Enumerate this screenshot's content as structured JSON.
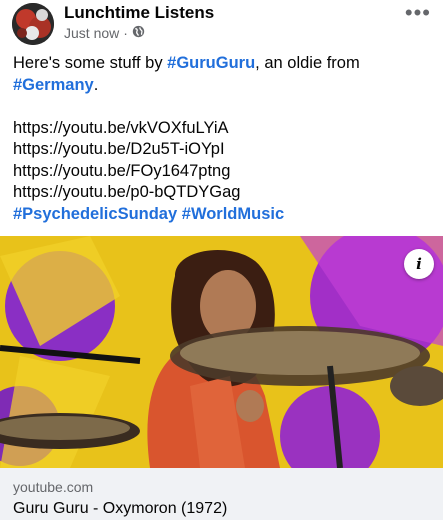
{
  "header": {
    "page_name": "Lunchtime Listens",
    "timestamp": "Just now",
    "separator": "·",
    "privacy_icon": "globe-icon",
    "more_label": "•••"
  },
  "post": {
    "intro_before": "Here's some stuff by ",
    "hashtag_guruguru": "#GuruGuru",
    "intro_middle": ", an oldie from",
    "hashtag_germany": "#Germany",
    "intro_end": ".",
    "links": [
      "https://youtu.be/vkVOXfuLYiA",
      "https://youtu.be/D2u5T-iOYpI",
      "https://youtu.be/FOy1647ptng",
      "https://youtu.be/p0-bQTDYGag"
    ],
    "hashtag_psychedelic": "#PsychedelicSunday",
    "hashtag_worldmusic": "#WorldMusic"
  },
  "media": {
    "info_label": "i",
    "info_icon": "info-icon"
  },
  "link_preview": {
    "domain": "youtube.com",
    "title": "Guru Guru - Oxymoron (1972)"
  },
  "colors": {
    "hashtag": "#216fdb",
    "secondary_text": "#65676b",
    "card_bg": "#f0f2f5"
  }
}
